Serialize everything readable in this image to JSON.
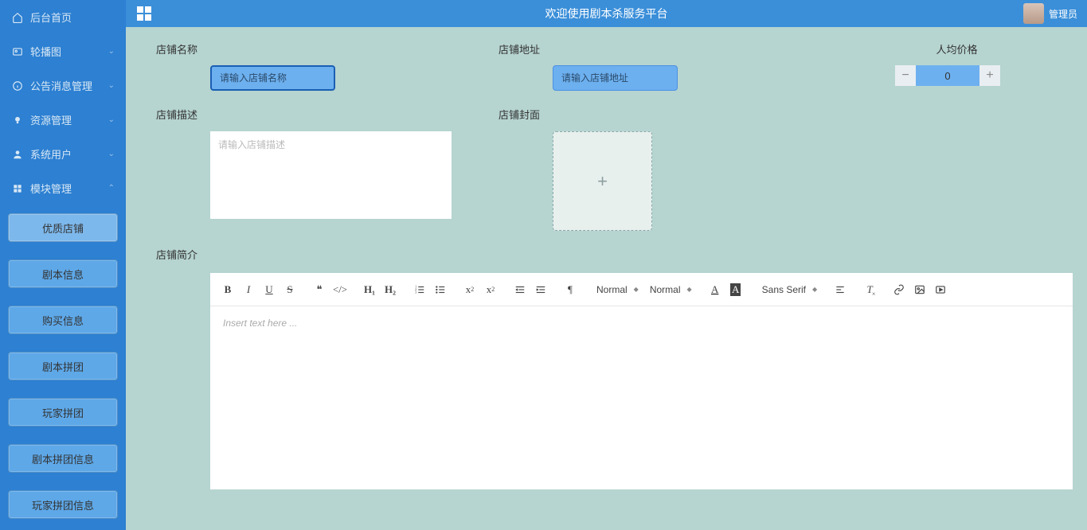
{
  "topbar": {
    "title": "欢迎使用剧本杀服务平台",
    "user_label": "管理员"
  },
  "sidebar": {
    "home": "后台首页",
    "items": [
      {
        "label": "轮播图"
      },
      {
        "label": "公告消息管理"
      },
      {
        "label": "资源管理"
      },
      {
        "label": "系统用户"
      },
      {
        "label": "模块管理"
      }
    ],
    "sub": [
      "优质店铺",
      "剧本信息",
      "购买信息",
      "剧本拼团",
      "玩家拼团",
      "剧本拼团信息",
      "玩家拼团信息"
    ]
  },
  "form": {
    "name_label": "店铺名称",
    "name_placeholder": "请输入店铺名称",
    "addr_label": "店铺地址",
    "addr_placeholder": "请输入店铺地址",
    "price_label": "人均价格",
    "price_value": "0",
    "desc_label": "店铺描述",
    "desc_placeholder": "请输入店铺描述",
    "cover_label": "店铺封面",
    "intro_label": "店铺简介"
  },
  "editor": {
    "placeholder": "Insert text here ...",
    "sel_header": "Normal",
    "sel_size": "Normal",
    "sel_font": "Sans Serif"
  }
}
